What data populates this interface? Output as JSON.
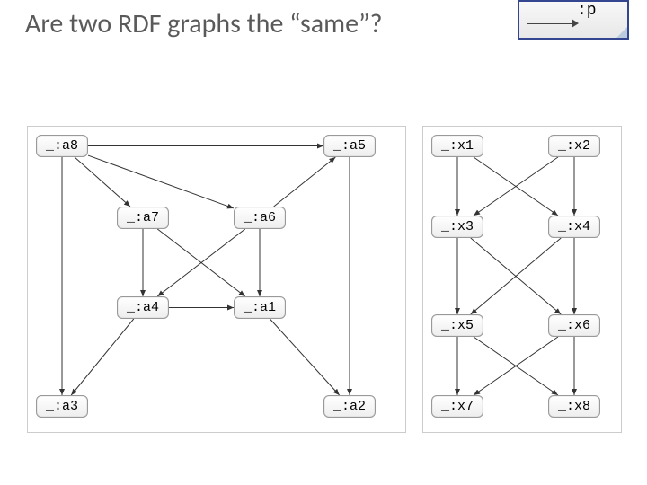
{
  "title": "Are two RDF graphs the “same”?",
  "legend": {
    "label": ":p"
  },
  "left_graph": {
    "nodes": {
      "a8": "_:a8",
      "a5": "_:a5",
      "a7": "_:a7",
      "a6": "_:a6",
      "a4": "_:a4",
      "a1": "_:a1",
      "a3": "_:a3",
      "a2": "_:a2"
    },
    "edges": [
      [
        "a8",
        "a5"
      ],
      [
        "a8",
        "a7"
      ],
      [
        "a8",
        "a6"
      ],
      [
        "a8",
        "a3"
      ],
      [
        "a7",
        "a4"
      ],
      [
        "a7",
        "a1"
      ],
      [
        "a6",
        "a4"
      ],
      [
        "a6",
        "a1"
      ],
      [
        "a6",
        "a5"
      ],
      [
        "a4",
        "a3"
      ],
      [
        "a4",
        "a1"
      ],
      [
        "a1",
        "a2"
      ],
      [
        "a5",
        "a2"
      ]
    ]
  },
  "right_graph": {
    "nodes": {
      "x1": "_:x1",
      "x2": "_:x2",
      "x3": "_:x3",
      "x4": "_:x4",
      "x5": "_:x5",
      "x6": "_:x6",
      "x7": "_:x7",
      "x8": "_:x8"
    },
    "edges": [
      [
        "x1",
        "x4"
      ],
      [
        "x2",
        "x3"
      ],
      [
        "x3",
        "x6"
      ],
      [
        "x4",
        "x5"
      ],
      [
        "x5",
        "x8"
      ],
      [
        "x6",
        "x7"
      ],
      [
        "x1",
        "x3"
      ],
      [
        "x2",
        "x4"
      ],
      [
        "x3",
        "x5"
      ],
      [
        "x4",
        "x6"
      ],
      [
        "x5",
        "x7"
      ],
      [
        "x6",
        "x8"
      ]
    ]
  }
}
